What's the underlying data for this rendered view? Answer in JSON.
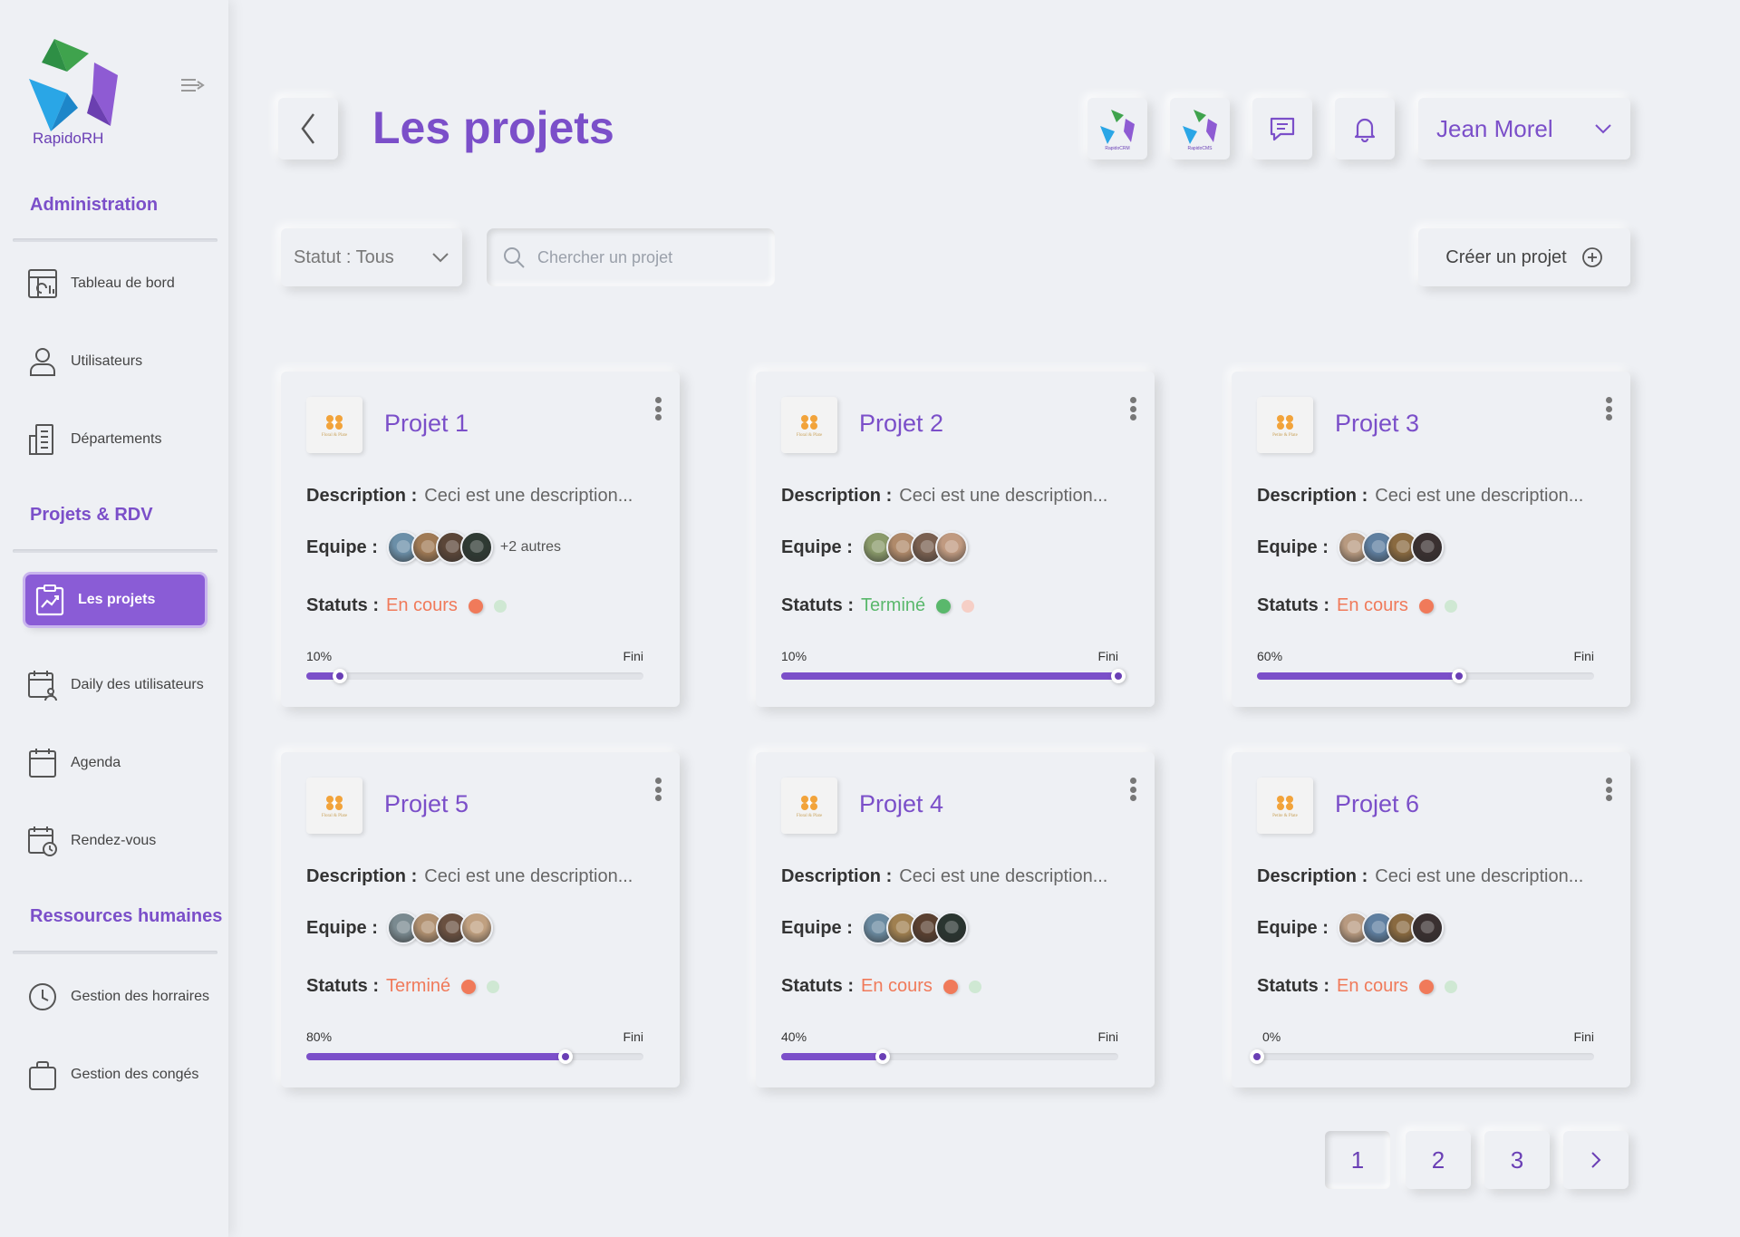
{
  "app": {
    "logo_text_1": "Rapido",
    "logo_text_2": "RH"
  },
  "sidebar": {
    "sections": [
      {
        "title": "Administration",
        "items": [
          {
            "label": "Tableau de bord",
            "icon": "dashboard-icon"
          },
          {
            "label": "Utilisateurs",
            "icon": "user-icon"
          },
          {
            "label": "Départements",
            "icon": "building-icon"
          }
        ]
      },
      {
        "title": "Projets & RDV",
        "items": [
          {
            "label": "Les projets",
            "icon": "projects-icon",
            "active": true
          },
          {
            "label": "Daily des utilisateurs",
            "icon": "calendar-user-icon"
          },
          {
            "label": "Agenda",
            "icon": "calendar-icon"
          },
          {
            "label": "Rendez-vous",
            "icon": "calendar-clock-icon"
          }
        ]
      },
      {
        "title": "Ressources humaines",
        "items": [
          {
            "label": "Gestion des horraires",
            "icon": "clock-icon"
          },
          {
            "label": "Gestion des congés",
            "icon": "bag-icon"
          }
        ]
      }
    ]
  },
  "header": {
    "title": "Les projets",
    "apps": [
      {
        "caption": "RapidoCRM"
      },
      {
        "caption": "RapidoCMS"
      }
    ],
    "user_name": "Jean Morel"
  },
  "toolbar": {
    "status_filter": "Statut : Tous",
    "search_placeholder": "Chercher un projet",
    "create_label": "Créer un projet"
  },
  "labels": {
    "description": "Description :",
    "team": "Equipe :",
    "status": "Statuts :",
    "done": "Fini"
  },
  "colors": {
    "accent": "#7b4fc9",
    "in_progress": "#f07a5a",
    "finished": "#5ab86c"
  },
  "projects": [
    {
      "title": "Projet 1",
      "logo_caption": "Floral & Plate",
      "description": "Ceci est une description...",
      "team": [
        "#6b8fa8",
        "#a07a55",
        "#5b4638",
        "#2f3a33"
      ],
      "others": "+2 autres",
      "status": "En cours",
      "status_type": "in_progress",
      "progress": 10,
      "progress_label": "10%"
    },
    {
      "title": "Projet 2",
      "logo_caption": "Floral & Plate",
      "description": "Ceci est une description...",
      "team": [
        "#8a9a6a",
        "#b08a6a",
        "#7a6050",
        "#c09a80"
      ],
      "others": "",
      "status": "Terminé",
      "status_type": "finished",
      "progress": 100,
      "progress_label": "10%"
    },
    {
      "title": "Projet 3",
      "logo_caption": "Petite & Plate",
      "description": "Ceci est une description...",
      "team": [
        "#b89a80",
        "#5f7fa0",
        "#8a6a40",
        "#3a3030"
      ],
      "others": "",
      "status": "En cours",
      "status_type": "in_progress",
      "progress": 60,
      "progress_label": "60%"
    },
    {
      "title": "Projet 5",
      "logo_caption": "Floral & Plate",
      "description": "Ceci est une description...",
      "team": [
        "#7a8a90",
        "#b09070",
        "#6a5040",
        "#c0a080"
      ],
      "others": "",
      "status": "Terminé",
      "status_type": "in_progress",
      "progress": 77,
      "progress_label": "80%"
    },
    {
      "title": "Projet 4",
      "logo_caption": "Floral & Plate",
      "description": "Ceci est une description...",
      "team": [
        "#6a8aa0",
        "#a08050",
        "#5a4030",
        "#2a3530"
      ],
      "others": "",
      "status": "En cours",
      "status_type": "in_progress",
      "progress": 30,
      "progress_label": "40%"
    },
    {
      "title": "Projet 6",
      "logo_caption": "Petite & Plate",
      "description": "Ceci est une description...",
      "team": [
        "#b89a80",
        "#5f7fa0",
        "#8a6a40",
        "#3a3030"
      ],
      "others": "",
      "status": "En cours",
      "status_type": "in_progress",
      "progress": 0,
      "progress_label": "0%"
    }
  ],
  "pagination": {
    "pages": [
      "1",
      "2",
      "3"
    ],
    "current": "1"
  }
}
